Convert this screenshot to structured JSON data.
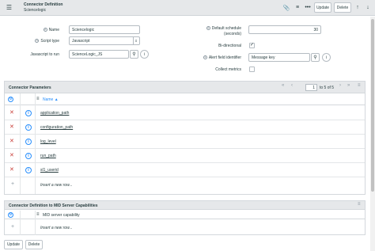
{
  "header": {
    "title": "Connector Definition",
    "subtitle": "Sciencelogic",
    "update_label": "Update",
    "delete_label": "Delete"
  },
  "form": {
    "name_label": "Name",
    "name_value": "Sciencelogic",
    "script_type_label": "Script type",
    "script_type_value": "Javascript",
    "js_to_run_label": "Javascript to run",
    "js_to_run_value": "ScienceLogic_JS",
    "default_schedule_label": "Default schedule",
    "default_schedule_sub": "(seconds)",
    "default_schedule_value": "30",
    "bidirectional_label": "Bi-directional",
    "bidirectional_checked": true,
    "alert_field_label": "Alert field identifier",
    "alert_field_value": "Message key",
    "collect_metrics_label": "Collect metrics",
    "collect_metrics_checked": false
  },
  "connector_parameters": {
    "title": "Connector Parameters",
    "column_name": "Name",
    "page_current": "1",
    "page_of": "to 5 of 5",
    "rows": [
      "application_path",
      "configuration_path",
      "log_level",
      "run_path",
      "sl1_userid"
    ],
    "insert_label": "Insert a new row..."
  },
  "mid_capabilities": {
    "title": "Connector Definition to MID Server Capabilities",
    "column_name": "MID server capability",
    "insert_label": "Insert a new row..."
  },
  "footer": {
    "update_label": "Update",
    "delete_label": "Delete"
  }
}
